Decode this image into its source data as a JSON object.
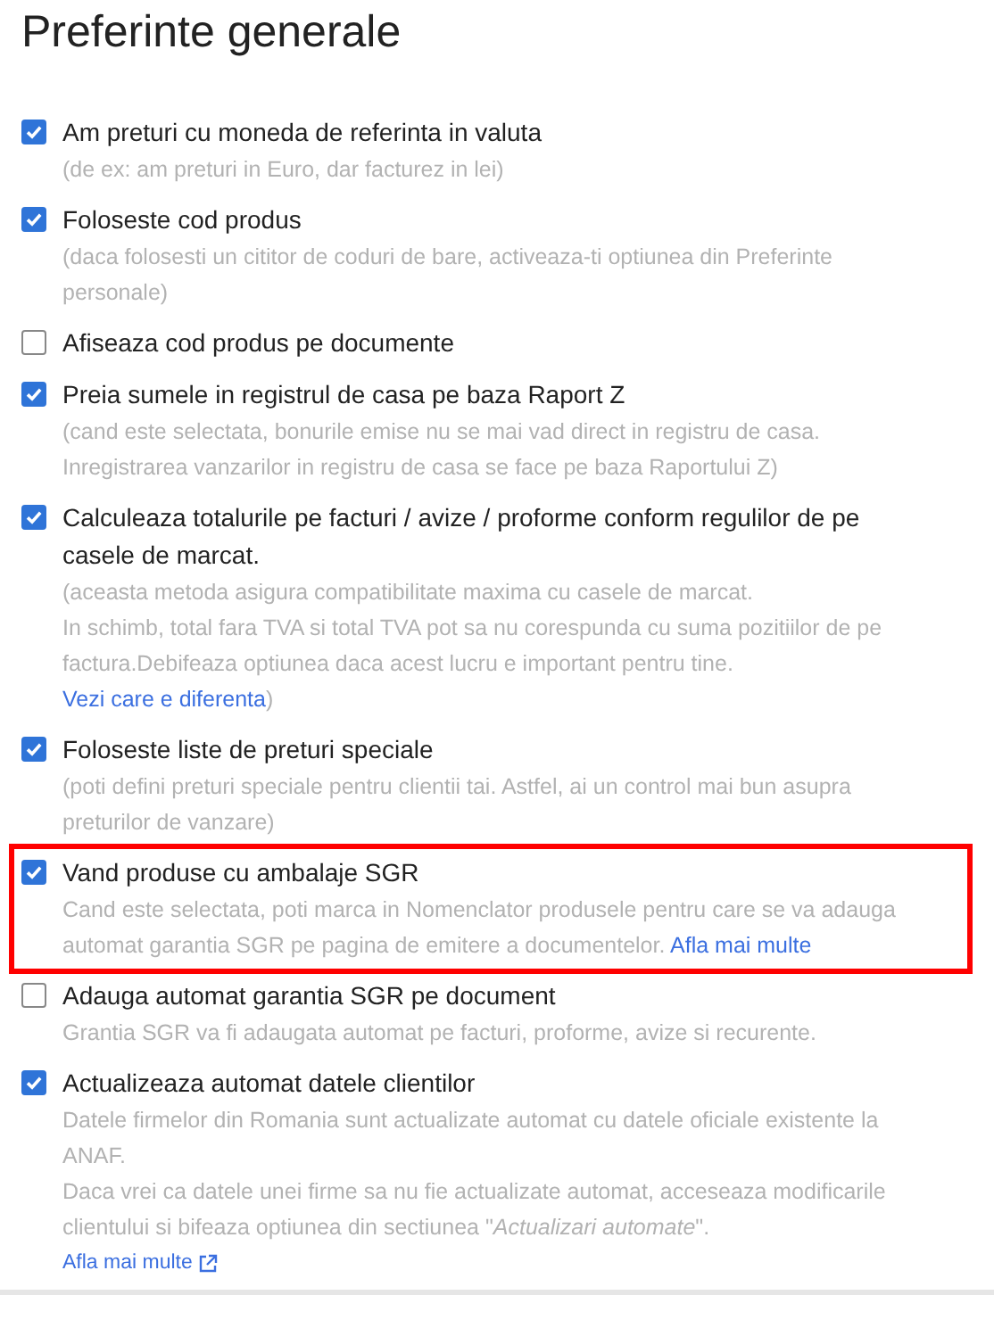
{
  "title": "Preferinte generale",
  "options": [
    {
      "label": "Am preturi cu moneda de referinta in valuta",
      "checked": true,
      "highlighted": false,
      "description": [
        "(de ex: am preturi in Euro, dar facturez in lei)"
      ]
    },
    {
      "label": "Foloseste cod produs",
      "checked": true,
      "highlighted": false,
      "description": [
        "(daca folosesti un cititor de coduri de bare, activeaza-ti optiunea din Preferinte personale)"
      ]
    },
    {
      "label": "Afiseaza cod produs pe documente",
      "checked": false,
      "highlighted": false
    },
    {
      "label": "Preia sumele in registrul de casa pe baza Raport Z",
      "checked": true,
      "highlighted": false,
      "description": [
        "(cand este selectata, bonurile emise nu se mai vad direct in registru de casa.",
        "Inregistrarea vanzarilor in registru de casa se face pe baza Raportului Z)"
      ]
    },
    {
      "label": "Calculeaza totalurile pe facturi / avize / proforme conform regulilor de pe casele de marcat.",
      "checked": true,
      "highlighted": false,
      "description": [
        "(aceasta metoda asigura compatibilitate maxima cu casele de marcat.",
        "In schimb, total fara TVA si total TVA pot sa nu corespunda cu suma pozitiilor de pe factura.Debifeaza optiunea daca acest lucru e important pentru tine."
      ],
      "link": {
        "text": "Vezi care e diferenta",
        "kind": "inline",
        "suffix": ")"
      }
    },
    {
      "label": "Foloseste liste de preturi speciale",
      "checked": true,
      "highlighted": false,
      "description": [
        "(poti defini preturi speciale pentru clientii tai. Astfel, ai un control mai bun asupra preturilor de vanzare)"
      ]
    },
    {
      "label": "Vand produse cu ambalaje SGR",
      "checked": true,
      "highlighted": true,
      "description": [
        "Cand este selectata, poti marca in Nomenclator produsele pentru care se va adauga automat garantia SGR pe pagina de emitere a documentelor."
      ],
      "link": {
        "text": "Afla mai multe",
        "kind": "inline"
      }
    },
    {
      "label": "Adauga automat garantia SGR pe document",
      "checked": false,
      "highlighted": false,
      "description": [
        "Grantia SGR va fi adaugata automat pe facturi, proforme, avize si recurente."
      ]
    },
    {
      "label": "Actualizeaza automat datele clientilor",
      "checked": true,
      "highlighted": false,
      "description": [
        "Datele firmelor din Romania sunt actualizate automat cu datele oficiale existente la ANAF.",
        "Daca vrei ca datele unei firme sa nu fie actualizate automat, acceseaza modificarile clientului si bifeaza optiunea din sectiunea \"*Actualizari automate*\"."
      ],
      "link": {
        "text": "Afla mai multe",
        "kind": "external"
      }
    }
  ]
}
